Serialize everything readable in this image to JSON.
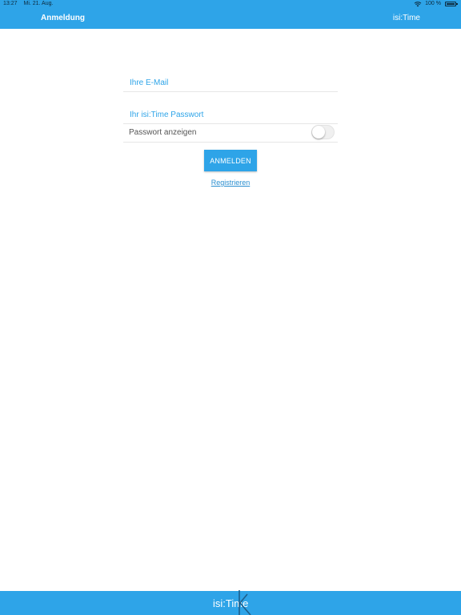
{
  "status_bar": {
    "time": "13:27",
    "date": "Mi. 21. Aug.",
    "battery": "100 %"
  },
  "header": {
    "title": "Anmeldung",
    "brand": "isi:Time"
  },
  "form": {
    "email_placeholder": "Ihre E-Mail",
    "email_value": "",
    "password_placeholder": "Ihr isi:Time Passwort",
    "password_value": "",
    "show_password_label": "Passwort anzeigen",
    "show_password_on": false,
    "login_button_label": "ANMELDEN",
    "register_link_label": "Registrieren"
  },
  "footer": {
    "logo_text": "isi:Time"
  },
  "colors": {
    "brand_blue": "#2ea4e8",
    "link_blue": "#2b8fd0"
  },
  "icons": {
    "wifi": "wifi-icon",
    "battery": "battery-icon",
    "logo_mark": "isitime-k-mark-icon"
  }
}
